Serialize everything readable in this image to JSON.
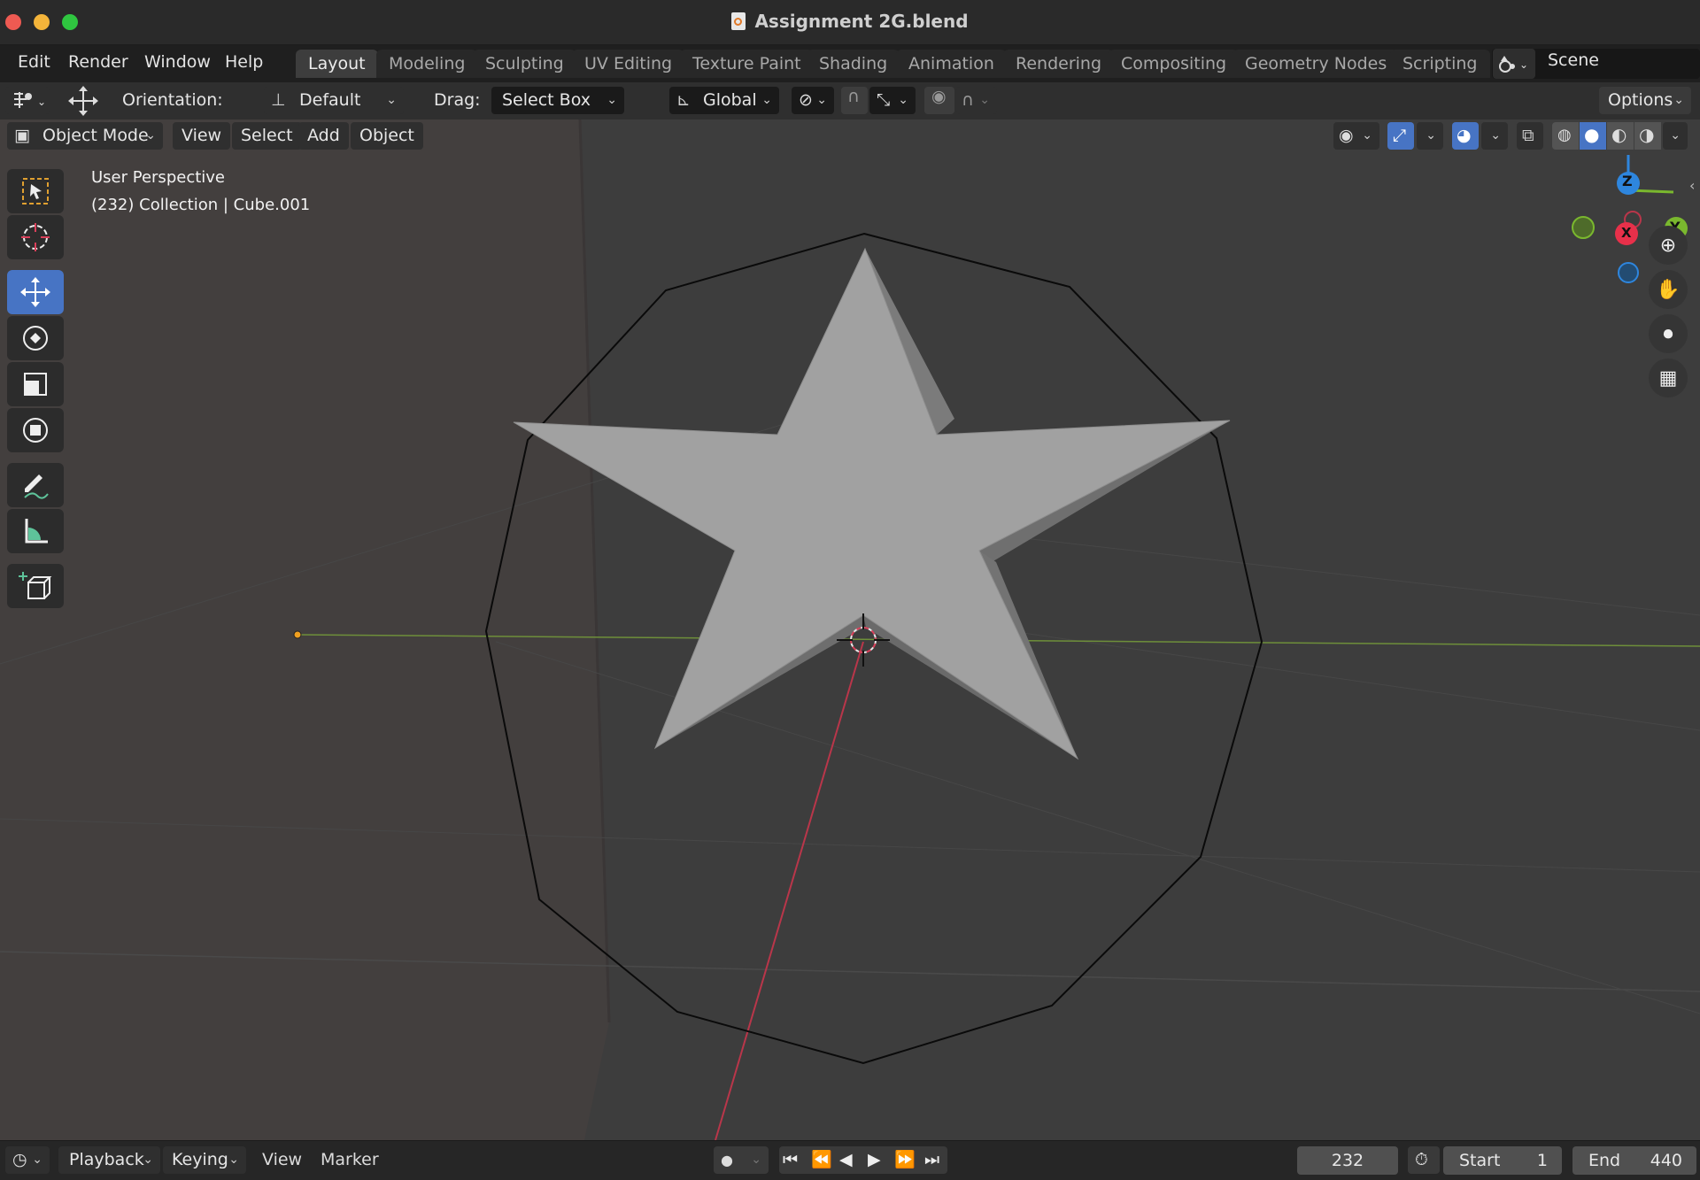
{
  "window": {
    "title": "Assignment 2G.blend",
    "file_icon": "blend-file-icon"
  },
  "menubar": {
    "menus": [
      "Edit",
      "Render",
      "Window",
      "Help"
    ],
    "workspace_tabs": [
      "Layout",
      "Modeling",
      "Sculpting",
      "UV Editing",
      "Texture Paint",
      "Shading",
      "Animation",
      "Rendering",
      "Compositing",
      "Geometry Nodes",
      "Scripting"
    ],
    "active_tab": "Layout",
    "scene_value": "Scene"
  },
  "toolbar": {
    "orientation_label": "Orientation:",
    "orientation_value": "Default",
    "drag_label": "Drag:",
    "drag_value": "Select Box",
    "transform_orientation": "Global",
    "options_label": "Options"
  },
  "viewport_header": {
    "mode": "Object Mode",
    "menus": [
      "View",
      "Select",
      "Add",
      "Object"
    ]
  },
  "viewport": {
    "perspective_text": "User Perspective",
    "collection_text": "(232) Collection | Cube.001",
    "gizmo_axes": [
      "Z",
      "Y",
      "X"
    ],
    "axis_colors": {
      "x": "#e8304a",
      "y": "#7ab82e",
      "z": "#2e86de"
    }
  },
  "tools": [
    "select-box-tool",
    "cursor-tool",
    "move-tool",
    "rotate-tool",
    "scale-tool",
    "transform-tool",
    "annotate-tool",
    "measure-tool",
    "add-cube-tool"
  ],
  "timeline": {
    "menus": [
      "Playback",
      "Keying",
      "View",
      "Marker"
    ],
    "current_frame": "232",
    "start_label": "Start",
    "start_value": "1",
    "end_label": "End",
    "end_value": "440"
  }
}
